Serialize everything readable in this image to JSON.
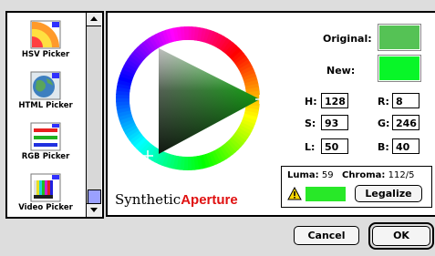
{
  "pickers": [
    {
      "label": "HSV Picker",
      "icon": "hsv-picker-icon"
    },
    {
      "label": "HTML Picker",
      "icon": "html-picker-icon"
    },
    {
      "label": "RGB Picker",
      "icon": "rgb-picker-icon"
    },
    {
      "label": "Video Picker",
      "icon": "video-picker-icon"
    }
  ],
  "swatches": {
    "original_label": "Original:",
    "new_label": "New:",
    "original_color": "#55c255",
    "new_color": "#08f628"
  },
  "hsl": {
    "h_label": "H:",
    "h": "128",
    "s_label": "S:",
    "s": "93",
    "l_label": "L:",
    "l": "50"
  },
  "rgb": {
    "r_label": "R:",
    "r": "8",
    "g_label": "G:",
    "g": "246",
    "b_label": "B:",
    "b": "40"
  },
  "luma": {
    "luma_label": "Luma:",
    "luma_value": "59",
    "chroma_label": "Chroma:",
    "chroma_value": "112/5",
    "legal_color": "#28e828",
    "legalize_label": "Legalize"
  },
  "logo": {
    "prefix": "Synthetic",
    "suffix": "Aperture"
  },
  "buttons": {
    "cancel": "Cancel",
    "ok": "OK"
  }
}
